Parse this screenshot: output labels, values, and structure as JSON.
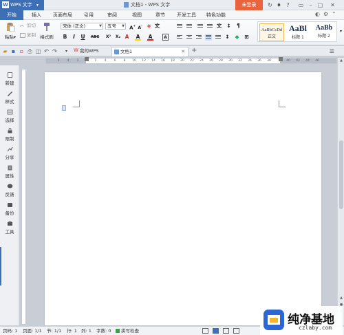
{
  "app": {
    "name": "WPS 文字",
    "window_title": "文档1 - WPS 文字",
    "login_label": "未登录"
  },
  "menu": {
    "tabs": [
      "开始",
      "插入",
      "页面布局",
      "引用",
      "审阅",
      "视图",
      "章节",
      "开发工具",
      "特色功能"
    ],
    "active_tab": "开始"
  },
  "ribbon": {
    "paste_label": "粘贴",
    "cut_label": "剪切",
    "copy_label": "复制",
    "format_painter_label": "格式刷",
    "font_name": "宋体 (正文)",
    "font_size": "五号",
    "format_buttons": [
      "B",
      "I",
      "U",
      "ABC",
      "X²",
      "X₂",
      "A",
      "A",
      "A"
    ],
    "styles": [
      {
        "sample": "AaBbCcDd",
        "name": "正文"
      },
      {
        "sample": "AaBl",
        "name": "标题 1"
      },
      {
        "sample": "AaBb",
        "name": "标题 2"
      }
    ]
  },
  "doc_tabs": {
    "home_tab": "我的WPS",
    "active_doc": "文档1"
  },
  "ruler": {
    "ticks": [
      "6",
      "4",
      "2",
      "2",
      "4",
      "6",
      "8",
      "10",
      "12",
      "14",
      "16",
      "18",
      "20",
      "22",
      "24",
      "26",
      "28",
      "30",
      "32",
      "34",
      "36",
      "38",
      "40",
      "42",
      "44",
      "46"
    ]
  },
  "sidebar": {
    "items": [
      "新建",
      "样式",
      "选择",
      "限制",
      "分享",
      "属性",
      "反馈",
      "备份",
      "工具"
    ]
  },
  "status": {
    "page_num": "页码: 1",
    "page": "页面: 1/1",
    "section": "节: 1/1",
    "row": "行: 1",
    "column": "列: 1",
    "word_count": "字数: 0",
    "spellcheck": "拼写检查"
  },
  "watermark": {
    "title": "纯净基地",
    "url": "czlaby.com"
  },
  "colors": {
    "accent": "#3d6fb6",
    "login": "#e9643c",
    "page": "#ffffff",
    "background": "#c9ced6"
  }
}
